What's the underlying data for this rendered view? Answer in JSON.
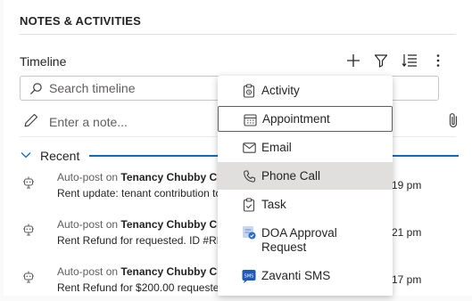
{
  "header": {
    "title": "NOTES & ACTIVITIES"
  },
  "timeline": {
    "label": "Timeline",
    "actions": [
      {
        "name": "add",
        "icon": "plus-icon"
      },
      {
        "name": "filter",
        "icon": "filter-icon"
      },
      {
        "name": "sort",
        "icon": "sort-icon"
      },
      {
        "name": "more",
        "icon": "more-vertical-icon"
      }
    ],
    "search_placeholder": "Search timeline",
    "note_placeholder": "Enter a note..."
  },
  "recent": {
    "label": "Recent",
    "accent": "#0f6cbd"
  },
  "items": [
    {
      "prefix": "Auto-post on ",
      "entity": "Tenancy Chubby Chee",
      "text": "Rent update: tenant contribution to",
      "time": "19 pm"
    },
    {
      "prefix": "Auto-post on ",
      "entity": "Tenancy Chubby Chee",
      "text": "Rent Refund for  requested. ID #RR-",
      "time": "21 pm"
    },
    {
      "prefix": "Auto-post on ",
      "entity": "Tenancy Chubby Chee",
      "text": "Rent Refund for $200.00 requested.",
      "time": "17 pm"
    }
  ],
  "menu": {
    "items": [
      {
        "label": "Activity",
        "icon": "clipboard-icon"
      },
      {
        "label": "Appointment",
        "icon": "calendar-icon",
        "state": "focused"
      },
      {
        "label": "Email",
        "icon": "mail-icon"
      },
      {
        "label": "Phone Call",
        "icon": "phone-icon",
        "state": "hover"
      },
      {
        "label": "Task",
        "icon": "task-icon"
      },
      {
        "label": "DOA Approval Request",
        "label_line1": "DOA Approval",
        "label_line2": "Request",
        "icon": "doa-approval-icon"
      },
      {
        "label": "Zavanti SMS",
        "icon": "sms-icon"
      }
    ]
  }
}
